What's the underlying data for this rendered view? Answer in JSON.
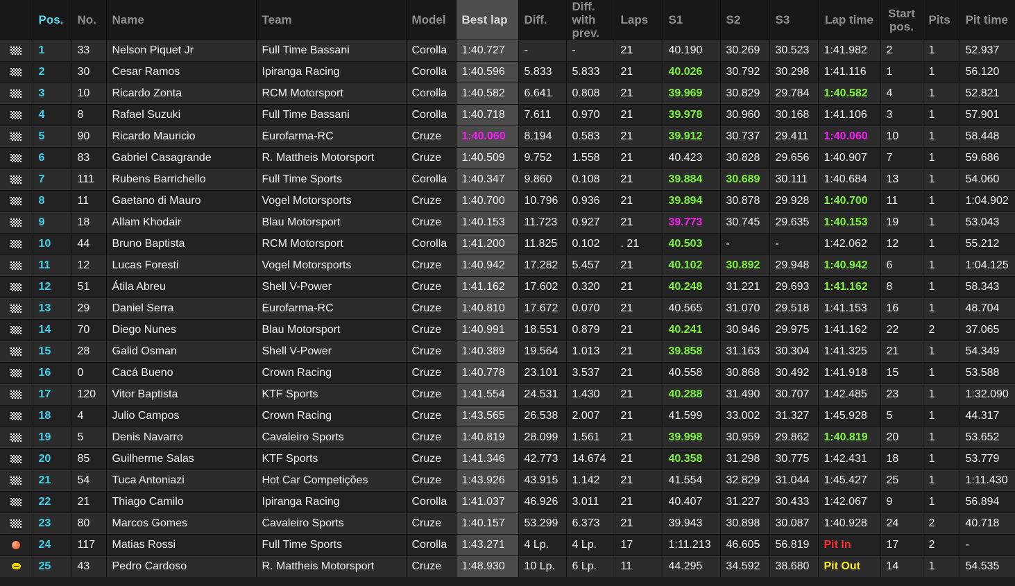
{
  "headers": {
    "pos": "Pos.",
    "no": "No.",
    "name": "Name",
    "team": "Team",
    "model": "Model",
    "best_lap": "Best lap",
    "diff": "Diff.",
    "diff_prev": "Diff. with prev.",
    "laps": "Laps",
    "s1": "S1",
    "s2": "S2",
    "s3": "S3",
    "lap_time": "Lap time",
    "start_pos": "Start pos.",
    "pits": "Pits",
    "pit_time": "Pit time"
  },
  "colors": {
    "personal_best": "#7cf23a",
    "overall_best": "#f61ff4",
    "pit_in": "#ff2a2a",
    "pit_out": "#ffe81a",
    "position": "#3fd3f0"
  },
  "rows": [
    {
      "flag": "checkered-flag-icon",
      "pos": "1",
      "no": "33",
      "name": "Nelson Piquet Jr",
      "team": "Full Time Bassani",
      "model": "Corolla",
      "best": "1:40.727",
      "best_s": "",
      "diff": "-",
      "diff_prev": "-",
      "laps": "21",
      "s1": "40.190",
      "s1_s": "",
      "s2": "30.269",
      "s2_s": "",
      "s3": "30.523",
      "s3_s": "",
      "lap": "1:41.982",
      "lap_s": "",
      "start": "2",
      "pits": "1",
      "pit_time": "52.937"
    },
    {
      "flag": "checkered-flag-icon",
      "pos": "2",
      "no": "30",
      "name": "Cesar Ramos",
      "team": "Ipiranga Racing",
      "model": "Corolla",
      "best": "1:40.596",
      "best_s": "",
      "diff": "5.833",
      "diff_prev": "5.833",
      "laps": "21",
      "s1": "40.026",
      "s1_s": "green",
      "s2": "30.792",
      "s2_s": "",
      "s3": "30.298",
      "s3_s": "",
      "lap": "1:41.116",
      "lap_s": "",
      "start": "1",
      "pits": "1",
      "pit_time": "56.120"
    },
    {
      "flag": "checkered-flag-icon",
      "pos": "3",
      "no": "10",
      "name": "Ricardo Zonta",
      "team": "RCM Motorsport",
      "model": "Corolla",
      "best": "1:40.582",
      "best_s": "",
      "diff": "6.641",
      "diff_prev": "0.808",
      "laps": "21",
      "s1": "39.969",
      "s1_s": "green",
      "s2": "30.829",
      "s2_s": "",
      "s3": "29.784",
      "s3_s": "",
      "lap": "1:40.582",
      "lap_s": "green",
      "start": "4",
      "pits": "1",
      "pit_time": "52.821"
    },
    {
      "flag": "checkered-flag-icon",
      "pos": "4",
      "no": "8",
      "name": "Rafael Suzuki",
      "team": "Full Time Bassani",
      "model": "Corolla",
      "best": "1:40.718",
      "best_s": "",
      "diff": "7.611",
      "diff_prev": "0.970",
      "laps": "21",
      "s1": "39.978",
      "s1_s": "green",
      "s2": "30.960",
      "s2_s": "",
      "s3": "30.168",
      "s3_s": "",
      "lap": "1:41.106",
      "lap_s": "",
      "start": "3",
      "pits": "1",
      "pit_time": "57.901"
    },
    {
      "flag": "checkered-flag-icon",
      "pos": "5",
      "no": "90",
      "name": "Ricardo Mauricio",
      "team": "Eurofarma-RC",
      "model": "Cruze",
      "best": "1:40.060",
      "best_s": "purple",
      "diff": "8.194",
      "diff_prev": "0.583",
      "laps": "21",
      "s1": "39.912",
      "s1_s": "green",
      "s2": "30.737",
      "s2_s": "",
      "s3": "29.411",
      "s3_s": "",
      "lap": "1:40.060",
      "lap_s": "purple",
      "start": "10",
      "pits": "1",
      "pit_time": "58.448"
    },
    {
      "flag": "checkered-flag-icon",
      "pos": "6",
      "no": "83",
      "name": "Gabriel Casagrande",
      "team": "R. Mattheis Motorsport",
      "model": "Cruze",
      "best": "1:40.509",
      "best_s": "",
      "diff": "9.752",
      "diff_prev": "1.558",
      "laps": "21",
      "s1": "40.423",
      "s1_s": "",
      "s2": "30.828",
      "s2_s": "",
      "s3": "29.656",
      "s3_s": "",
      "lap": "1:40.907",
      "lap_s": "",
      "start": "7",
      "pits": "1",
      "pit_time": "59.686"
    },
    {
      "flag": "checkered-flag-icon",
      "pos": "7",
      "no": "111",
      "name": "Rubens Barrichello",
      "team": "Full Time Sports",
      "model": "Corolla",
      "best": "1:40.347",
      "best_s": "",
      "diff": "9.860",
      "diff_prev": "0.108",
      "laps": "21",
      "s1": "39.884",
      "s1_s": "green",
      "s2": "30.689",
      "s2_s": "green",
      "s3": "30.111",
      "s3_s": "",
      "lap": "1:40.684",
      "lap_s": "",
      "start": "13",
      "pits": "1",
      "pit_time": "54.060"
    },
    {
      "flag": "checkered-flag-icon",
      "pos": "8",
      "no": "11",
      "name": "Gaetano di Mauro",
      "team": "Vogel Motorsports",
      "model": "Cruze",
      "best": "1:40.700",
      "best_s": "",
      "diff": "10.796",
      "diff_prev": "0.936",
      "laps": "21",
      "s1": "39.894",
      "s1_s": "green",
      "s2": "30.878",
      "s2_s": "",
      "s3": "29.928",
      "s3_s": "",
      "lap": "1:40.700",
      "lap_s": "green",
      "start": "11",
      "pits": "1",
      "pit_time": "1:04.902"
    },
    {
      "flag": "checkered-flag-icon",
      "pos": "9",
      "no": "18",
      "name": "Allam Khodair",
      "team": "Blau Motorsport",
      "model": "Cruze",
      "best": "1:40.153",
      "best_s": "",
      "diff": "11.723",
      "diff_prev": "0.927",
      "laps": "21",
      "s1": "39.773",
      "s1_s": "purple",
      "s2": "30.745",
      "s2_s": "",
      "s3": "29.635",
      "s3_s": "",
      "lap": "1:40.153",
      "lap_s": "green",
      "start": "19",
      "pits": "1",
      "pit_time": "53.043"
    },
    {
      "flag": "checkered-flag-icon",
      "pos": "10",
      "no": "44",
      "name": "Bruno Baptista",
      "team": "RCM Motorsport",
      "model": "Corolla",
      "best": "1:41.200",
      "best_s": "",
      "diff": "11.825",
      "diff_prev": "0.102",
      "laps": ". 21",
      "s1": "40.503",
      "s1_s": "green",
      "s2": "-",
      "s2_s": "",
      "s3": "-",
      "s3_s": "",
      "lap": "1:42.062",
      "lap_s": "",
      "start": "12",
      "pits": "1",
      "pit_time": "55.212"
    },
    {
      "flag": "checkered-flag-icon",
      "pos": "11",
      "no": "12",
      "name": "Lucas Foresti",
      "team": "Vogel Motorsports",
      "model": "Cruze",
      "best": "1:40.942",
      "best_s": "",
      "diff": "17.282",
      "diff_prev": "5.457",
      "laps": "21",
      "s1": "40.102",
      "s1_s": "green",
      "s2": "30.892",
      "s2_s": "green",
      "s3": "29.948",
      "s3_s": "",
      "lap": "1:40.942",
      "lap_s": "green",
      "start": "6",
      "pits": "1",
      "pit_time": "1:04.125"
    },
    {
      "flag": "checkered-flag-icon",
      "pos": "12",
      "no": "51",
      "name": "Átila Abreu",
      "team": "Shell V-Power",
      "model": "Cruze",
      "best": "1:41.162",
      "best_s": "",
      "diff": "17.602",
      "diff_prev": "0.320",
      "laps": "21",
      "s1": "40.248",
      "s1_s": "green",
      "s2": "31.221",
      "s2_s": "",
      "s3": "29.693",
      "s3_s": "",
      "lap": "1:41.162",
      "lap_s": "green",
      "start": "8",
      "pits": "1",
      "pit_time": "58.343"
    },
    {
      "flag": "checkered-flag-icon",
      "pos": "13",
      "no": "29",
      "name": "Daniel Serra",
      "team": "Eurofarma-RC",
      "model": "Cruze",
      "best": "1:40.810",
      "best_s": "",
      "diff": "17.672",
      "diff_prev": "0.070",
      "laps": "21",
      "s1": "40.565",
      "s1_s": "",
      "s2": "31.070",
      "s2_s": "",
      "s3": "29.518",
      "s3_s": "",
      "lap": "1:41.153",
      "lap_s": "",
      "start": "16",
      "pits": "1",
      "pit_time": "48.704"
    },
    {
      "flag": "checkered-flag-icon",
      "pos": "14",
      "no": "70",
      "name": "Diego Nunes",
      "team": "Blau Motorsport",
      "model": "Cruze",
      "best": "1:40.991",
      "best_s": "",
      "diff": "18.551",
      "diff_prev": "0.879",
      "laps": "21",
      "s1": "40.241",
      "s1_s": "green",
      "s2": "30.946",
      "s2_s": "",
      "s3": "29.975",
      "s3_s": "",
      "lap": "1:41.162",
      "lap_s": "",
      "start": "22",
      "pits": "2",
      "pit_time": "37.065"
    },
    {
      "flag": "checkered-flag-icon",
      "pos": "15",
      "no": "28",
      "name": "Galid Osman",
      "team": "Shell V-Power",
      "model": "Cruze",
      "best": "1:40.389",
      "best_s": "",
      "diff": "19.564",
      "diff_prev": "1.013",
      "laps": "21",
      "s1": "39.858",
      "s1_s": "green",
      "s2": "31.163",
      "s2_s": "",
      "s3": "30.304",
      "s3_s": "",
      "lap": "1:41.325",
      "lap_s": "",
      "start": "21",
      "pits": "1",
      "pit_time": "54.349"
    },
    {
      "flag": "checkered-flag-icon",
      "pos": "16",
      "no": "0",
      "name": "Cacá Bueno",
      "team": "Crown Racing",
      "model": "Cruze",
      "best": "1:40.778",
      "best_s": "",
      "diff": "23.101",
      "diff_prev": "3.537",
      "laps": "21",
      "s1": "40.558",
      "s1_s": "",
      "s2": "30.868",
      "s2_s": "",
      "s3": "30.492",
      "s3_s": "",
      "lap": "1:41.918",
      "lap_s": "",
      "start": "15",
      "pits": "1",
      "pit_time": "53.588"
    },
    {
      "flag": "checkered-flag-icon",
      "pos": "17",
      "no": "120",
      "name": "Vitor Baptista",
      "team": "KTF Sports",
      "model": "Cruze",
      "best": "1:41.554",
      "best_s": "",
      "diff": "24.531",
      "diff_prev": "1.430",
      "laps": "21",
      "s1": "40.288",
      "s1_s": "green",
      "s2": "31.490",
      "s2_s": "",
      "s3": "30.707",
      "s3_s": "",
      "lap": "1:42.485",
      "lap_s": "",
      "start": "23",
      "pits": "1",
      "pit_time": "1:32.090"
    },
    {
      "flag": "checkered-flag-icon",
      "pos": "18",
      "no": "4",
      "name": "Julio Campos",
      "team": "Crown Racing",
      "model": "Cruze",
      "best": "1:43.565",
      "best_s": "",
      "diff": "26.538",
      "diff_prev": "2.007",
      "laps": "21",
      "s1": "41.599",
      "s1_s": "",
      "s2": "33.002",
      "s2_s": "",
      "s3": "31.327",
      "s3_s": "",
      "lap": "1:45.928",
      "lap_s": "",
      "start": "5",
      "pits": "1",
      "pit_time": "44.317"
    },
    {
      "flag": "checkered-flag-icon",
      "pos": "19",
      "no": "5",
      "name": "Denis Navarro",
      "team": "Cavaleiro Sports",
      "model": "Cruze",
      "best": "1:40.819",
      "best_s": "",
      "diff": "28.099",
      "diff_prev": "1.561",
      "laps": "21",
      "s1": "39.998",
      "s1_s": "green",
      "s2": "30.959",
      "s2_s": "",
      "s3": "29.862",
      "s3_s": "",
      "lap": "1:40.819",
      "lap_s": "green",
      "start": "20",
      "pits": "1",
      "pit_time": "53.652"
    },
    {
      "flag": "checkered-flag-icon",
      "pos": "20",
      "no": "85",
      "name": "Guilherme Salas",
      "team": "KTF Sports",
      "model": "Cruze",
      "best": "1:41.346",
      "best_s": "",
      "diff": "42.773",
      "diff_prev": "14.674",
      "laps": "21",
      "s1": "40.358",
      "s1_s": "green",
      "s2": "31.298",
      "s2_s": "",
      "s3": "30.775",
      "s3_s": "",
      "lap": "1:42.431",
      "lap_s": "",
      "start": "18",
      "pits": "1",
      "pit_time": "53.779"
    },
    {
      "flag": "checkered-flag-icon",
      "pos": "21",
      "no": "54",
      "name": "Tuca Antoniazi",
      "team": "Hot Car Competições",
      "model": "Cruze",
      "best": "1:43.926",
      "best_s": "",
      "diff": "43.915",
      "diff_prev": "1.142",
      "laps": "21",
      "s1": "41.554",
      "s1_s": "",
      "s2": "32.829",
      "s2_s": "",
      "s3": "31.044",
      "s3_s": "",
      "lap": "1:45.427",
      "lap_s": "",
      "start": "25",
      "pits": "1",
      "pit_time": "1:11.430"
    },
    {
      "flag": "checkered-flag-icon",
      "pos": "22",
      "no": "21",
      "name": "Thiago Camilo",
      "team": "Ipiranga Racing",
      "model": "Corolla",
      "best": "1:41.037",
      "best_s": "",
      "diff": "46.926",
      "diff_prev": "3.011",
      "laps": "21",
      "s1": "40.407",
      "s1_s": "",
      "s2": "31.227",
      "s2_s": "",
      "s3": "30.433",
      "s3_s": "",
      "lap": "1:42.067",
      "lap_s": "",
      "start": "9",
      "pits": "1",
      "pit_time": "56.894"
    },
    {
      "flag": "checkered-flag-icon",
      "pos": "23",
      "no": "80",
      "name": "Marcos Gomes",
      "team": "Cavaleiro Sports",
      "model": "Cruze",
      "best": "1:40.157",
      "best_s": "",
      "diff": "53.299",
      "diff_prev": "6.373",
      "laps": "21",
      "s1": "39.943",
      "s1_s": "",
      "s2": "30.898",
      "s2_s": "",
      "s3": "30.087",
      "s3_s": "",
      "lap": "1:40.928",
      "lap_s": "",
      "start": "24",
      "pits": "2",
      "pit_time": "40.718"
    },
    {
      "flag": "pit-in-dot-icon",
      "pos": "24",
      "no": "117",
      "name": "Matias Rossi",
      "team": "Full Time Sports",
      "model": "Corolla",
      "best": "1:43.271",
      "best_s": "",
      "diff": "4 Lp.",
      "diff_prev": "4 Lp.",
      "laps": "17",
      "s1": "1:11.213",
      "s1_s": "",
      "s2": "46.605",
      "s2_s": "",
      "s3": "56.819",
      "s3_s": "",
      "lap": "Pit In",
      "lap_s": "pitin",
      "start": "17",
      "pits": "2",
      "pit_time": "-"
    },
    {
      "flag": "pit-out-dot-icon",
      "pos": "25",
      "no": "43",
      "name": "Pedro Cardoso",
      "team": "R. Mattheis Motorsport",
      "model": "Cruze",
      "best": "1:48.930",
      "best_s": "",
      "diff": "10 Lp.",
      "diff_prev": "6 Lp.",
      "laps": "11",
      "s1": "44.295",
      "s1_s": "",
      "s2": "34.592",
      "s2_s": "",
      "s3": "38.680",
      "s3_s": "",
      "lap": "Pit Out",
      "lap_s": "pitout",
      "start": "14",
      "pits": "1",
      "pit_time": "54.535"
    }
  ]
}
